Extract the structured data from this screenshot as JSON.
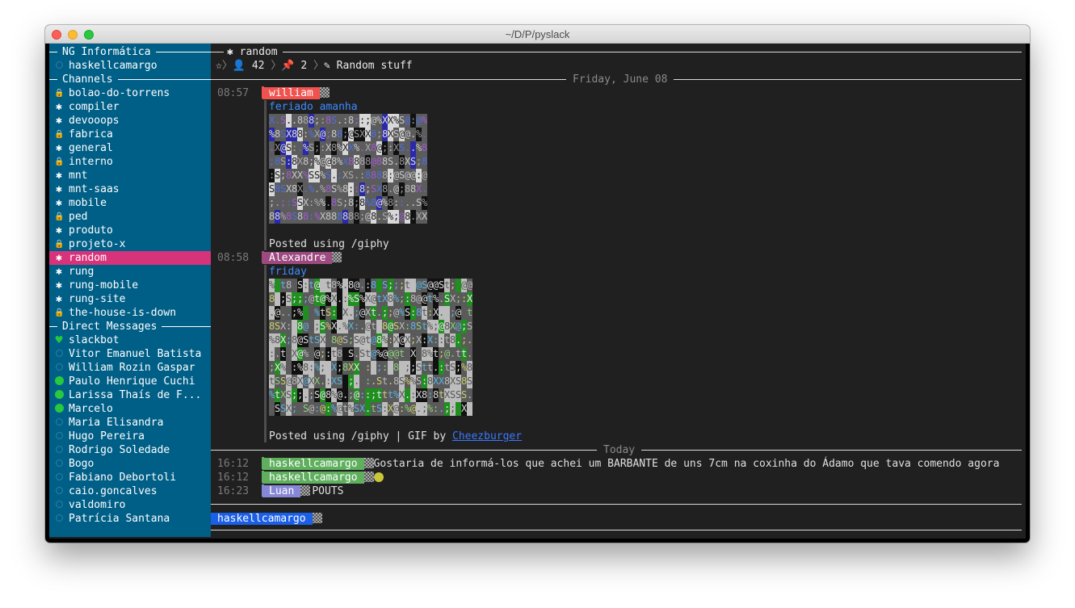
{
  "window": {
    "title": "~/D/P/pyslack"
  },
  "sidebar": {
    "team_name": "NG Informática",
    "current_user": "haskellcamargo",
    "channels_header": "Channels",
    "channels": [
      {
        "name": "bolao-do-torrens",
        "icon": "lock-icon"
      },
      {
        "name": "compiler",
        "icon": "gear-icon"
      },
      {
        "name": "devooops",
        "icon": "gear-icon"
      },
      {
        "name": "fabrica",
        "icon": "lock-icon"
      },
      {
        "name": "general",
        "icon": "gear-icon"
      },
      {
        "name": "interno",
        "icon": "lock-icon"
      },
      {
        "name": "mnt",
        "icon": "gear-icon"
      },
      {
        "name": "mnt-saas",
        "icon": "gear-icon"
      },
      {
        "name": "mobile",
        "icon": "gear-icon"
      },
      {
        "name": "ped",
        "icon": "lock-icon"
      },
      {
        "name": "produto",
        "icon": "gear-icon"
      },
      {
        "name": "projeto-x",
        "icon": "lock-icon"
      },
      {
        "name": "random",
        "icon": "gear-icon",
        "selected": true
      },
      {
        "name": "rung",
        "icon": "gear-icon"
      },
      {
        "name": "rung-mobile",
        "icon": "gear-icon"
      },
      {
        "name": "rung-site",
        "icon": "gear-icon"
      },
      {
        "name": "the-house-is-down",
        "icon": "lock-icon"
      }
    ],
    "dm_header": "Direct Messages",
    "direct_messages": [
      {
        "name": "slackbot",
        "status": "heart"
      },
      {
        "name": "Vitor Emanuel Batista",
        "status": "offline"
      },
      {
        "name": "William Rozin Gaspar",
        "status": "offline"
      },
      {
        "name": "Paulo Henrique Cuchi",
        "status": "online"
      },
      {
        "name": "Larissa Thaís de F...",
        "status": "online"
      },
      {
        "name": "Marcelo",
        "status": "online"
      },
      {
        "name": "Maria Elisandra",
        "status": "offline"
      },
      {
        "name": "Hugo Pereira",
        "status": "offline"
      },
      {
        "name": "Rodrigo Soledade",
        "status": "offline"
      },
      {
        "name": "Bogo",
        "status": "offline"
      },
      {
        "name": "Fabiano Debortoli",
        "status": "offline"
      },
      {
        "name": "caio.goncalves",
        "status": "offline"
      },
      {
        "name": "valdomiro",
        "status": "offline"
      },
      {
        "name": "Patrícia Santana",
        "status": "offline"
      }
    ]
  },
  "channel": {
    "name": "random",
    "members": "42",
    "pinned": "2",
    "topic": "Random stuff"
  },
  "dates": {
    "first": "Friday, June 08",
    "second": "Today"
  },
  "messages": [
    {
      "time": "08:57",
      "author": "william",
      "color": "#f0524f",
      "text": "feriado amanha",
      "footer": "Posted using /giphy"
    },
    {
      "time": "08:58",
      "author": "Alexandre",
      "color": "#9c4a80",
      "text": "friday",
      "footer": "Posted using /giphy | GIF by ",
      "link": "Cheezburger"
    },
    {
      "time": "16:12",
      "author": "haskellcamargo",
      "color": "#5faf5f",
      "text": "Gostaria de informá-los que achei um BARBANTE de uns 7cm na coxinha do Ádamo que tava comendo agora"
    },
    {
      "time": "16:12",
      "author": "haskellcamargo",
      "color": "#5faf5f",
      "text": ""
    },
    {
      "time": "16:23",
      "author": "Luan",
      "color": "#8787d7",
      "text": "POUTS"
    }
  ],
  "input": {
    "user": "haskellcamargo",
    "user_color": "#1a5fe6"
  },
  "colors": {
    "sidebar_bg": "#005f87",
    "selected_bg": "#d7337b",
    "terminal_bg": "#202020"
  }
}
